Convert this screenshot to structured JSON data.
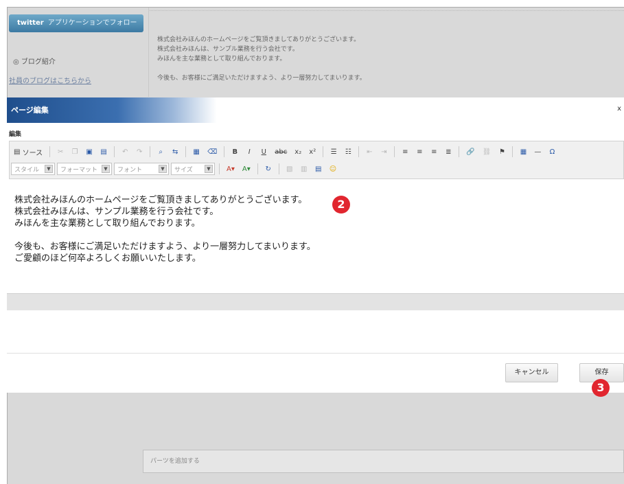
{
  "background": {
    "twitter_button": {
      "brand": "twitter",
      "label": "アプリケーションでフォロー"
    },
    "sidebar": {
      "blog_intro": "◎ ブログ紹介",
      "blog_link": "社員のブログはこちらから"
    },
    "content_lines": [
      "株式会社みほんのホームページをご覧頂きましてありがとうございます。",
      "株式会社みほんは、サンプル業務を行う会社です。",
      "みほんを主な業務として取り組んでおります。",
      "今後も、お客様にご満足いただけますよう、より一層努力してまいります。"
    ]
  },
  "dialog": {
    "title": "ページ編集",
    "close_symbol": "x",
    "section_label": "編集",
    "toolbar": {
      "source_label": "ソース",
      "row1_icons": [
        "cut-icon",
        "copy-icon",
        "paste-icon",
        "paste-text-icon",
        "undo-icon",
        "redo-icon",
        "find-icon",
        "replace-icon",
        "select-all-icon",
        "remove-format-icon",
        "bold-icon",
        "italic-icon",
        "underline-icon",
        "strike-icon",
        "subscript-icon",
        "superscript-icon",
        "numbered-list-icon",
        "bulleted-list-icon",
        "outdent-icon",
        "indent-icon",
        "align-left-icon",
        "align-center-icon",
        "align-right-icon",
        "justify-icon",
        "link-icon",
        "unlink-icon",
        "anchor-icon",
        "table-icon",
        "horizontal-rule-icon",
        "special-char-icon"
      ],
      "combos": [
        {
          "name": "style-combo",
          "label": "スタイル"
        },
        {
          "name": "format-combo",
          "label": "フォーマット"
        },
        {
          "name": "font-combo",
          "label": "フォント"
        },
        {
          "name": "size-combo",
          "label": "サイズ"
        }
      ],
      "row2_icons": [
        "text-color-icon",
        "background-color-icon",
        "refresh-icon",
        "image-icon",
        "flash-icon",
        "table2-icon",
        "smiley-icon"
      ]
    },
    "editor": {
      "lines": [
        "株式会社みほんのホームページをご覧頂きましてありがとうございます。",
        "株式会社みほんは、サンプル業務を行う会社です。",
        "みほんを主な業務として取り組んでおります。",
        "",
        "今後も、お客様にご満足いただけますよう、より一層努力してまいります。",
        "ご愛顧のほど何卒よろしくお願いいたします。"
      ]
    },
    "buttons": {
      "cancel": "キャンセル",
      "save": "保存"
    }
  },
  "markers": {
    "editor": "2",
    "save": "3"
  },
  "add_part": {
    "label": "パーツを追加する"
  },
  "colors": {
    "title_bar": "#1f4e8c",
    "marker": "#e1262f",
    "twitter": "#3c7aa3"
  }
}
